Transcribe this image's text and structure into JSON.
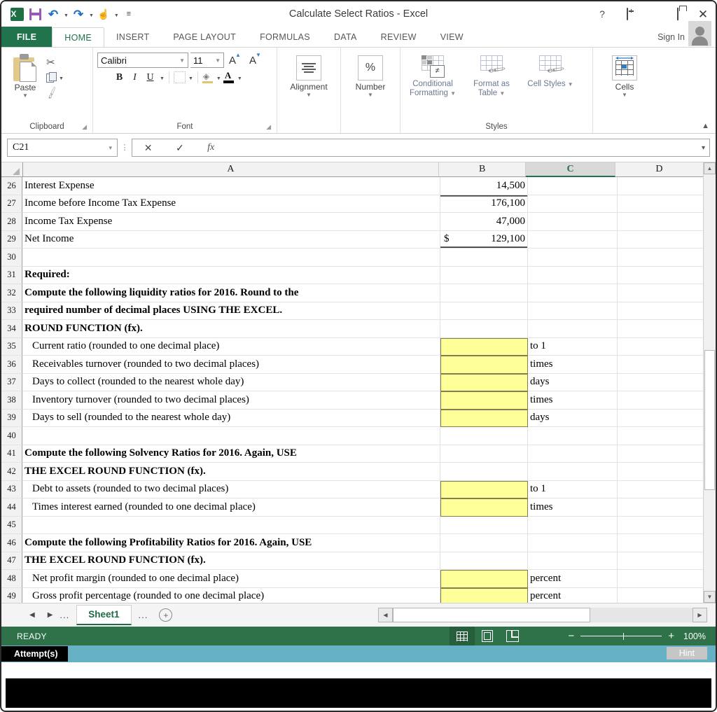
{
  "window": {
    "title": "Calculate Select Ratios - Excel",
    "help_icon": "?",
    "ribbon_display_icon": "ribbon-display-options-icon",
    "minimize_icon": "minimize-icon",
    "restore_icon": "restore-icon",
    "close_icon": "close-icon"
  },
  "quick_access": {
    "items": [
      {
        "name": "excel-logo-icon",
        "label": "X"
      },
      {
        "name": "save-icon",
        "label": ""
      },
      {
        "name": "undo-icon",
        "label": "↶"
      },
      {
        "name": "redo-icon",
        "label": "↷"
      },
      {
        "name": "touch-mode-icon",
        "label": "☝"
      },
      {
        "name": "customize-qat-icon",
        "label": "≡"
      }
    ]
  },
  "ribbon": {
    "tabs": [
      {
        "label": "FILE",
        "active": false,
        "file": true
      },
      {
        "label": "HOME",
        "active": true
      },
      {
        "label": "INSERT",
        "active": false
      },
      {
        "label": "PAGE LAYOUT",
        "active": false
      },
      {
        "label": "FORMULAS",
        "active": false
      },
      {
        "label": "DATA",
        "active": false
      },
      {
        "label": "REVIEW",
        "active": false
      },
      {
        "label": "VIEW",
        "active": false
      }
    ],
    "sign_in": "Sign In",
    "collapse_icon": "collapse-ribbon-icon",
    "groups": {
      "clipboard": {
        "label": "Clipboard",
        "paste": "Paste",
        "cut": "Cut",
        "copy": "Copy",
        "format_painter": "Format Painter",
        "dialog_launcher": "◢"
      },
      "font": {
        "label": "Font",
        "font_name": "Calibri",
        "font_size": "11",
        "grow_font": "A",
        "shrink_font": "A",
        "bold": "B",
        "italic": "I",
        "underline": "U",
        "borders": "borders-icon",
        "fill_color": "fill-color-icon",
        "font_color": "A",
        "dialog_launcher": "◢"
      },
      "alignment": {
        "label": "Alignment",
        "caret": "▾"
      },
      "number": {
        "label": "Number",
        "symbol": "%",
        "caret": "▾"
      },
      "styles": {
        "label": "Styles",
        "conditional_formatting": "Conditional Formatting",
        "format_as_table": "Format as Table",
        "cell_styles": "Cell Styles",
        "caret": "▾"
      },
      "cells": {
        "label": "Cells",
        "caret": "▾"
      }
    }
  },
  "formula_bar": {
    "name_box": "C21",
    "name_box_caret": "⌄",
    "cancel_icon": "✕",
    "enter_icon": "✓",
    "function_icon": "fx",
    "formula_value": "",
    "expand_caret": "⌄"
  },
  "grid": {
    "columns": [
      {
        "label": "A",
        "selected": false
      },
      {
        "label": "B",
        "selected": false
      },
      {
        "label": "C",
        "selected": true
      },
      {
        "label": "D",
        "selected": false
      }
    ],
    "rows": [
      {
        "n": "26",
        "a": "Interest Expense",
        "a_bold": false,
        "a_indent": false,
        "b": "14,500",
        "b_style": "",
        "c": ""
      },
      {
        "n": "27",
        "a": "Income before Income Tax Expense",
        "a_bold": false,
        "a_indent": false,
        "b": "176,100",
        "b_style": "topline",
        "c": ""
      },
      {
        "n": "28",
        "a": "Income Tax Expense",
        "a_bold": false,
        "a_indent": false,
        "b": "47,000",
        "b_style": "",
        "c": ""
      },
      {
        "n": "29",
        "a": "Net Income",
        "a_bold": false,
        "a_indent": false,
        "b": "129,100",
        "b_prefix": "$",
        "b_style": "topline dblbottom",
        "c": ""
      },
      {
        "n": "30",
        "a": "",
        "a_bold": false,
        "a_indent": false,
        "b": "",
        "b_style": "",
        "c": ""
      },
      {
        "n": "31",
        "a": "Required:",
        "a_bold": true,
        "a_indent": false,
        "b": "",
        "b_style": "",
        "c": ""
      },
      {
        "n": "32",
        "a": "Compute the following liquidity ratios for 2016. Round to the",
        "a_bold": true,
        "a_indent": false,
        "b": "",
        "b_style": "",
        "c": ""
      },
      {
        "n": "33",
        "a": "required number of decimal places USING THE EXCEL.",
        "a_bold": true,
        "a_indent": false,
        "b": "",
        "b_style": "",
        "c": ""
      },
      {
        "n": "34",
        "a": "ROUND FUNCTION (fx).",
        "a_bold": true,
        "a_indent": false,
        "b": "",
        "b_style": "",
        "c": ""
      },
      {
        "n": "35",
        "a": "Current ratio (rounded to one decimal place)",
        "a_bold": false,
        "a_indent": true,
        "b": "",
        "b_style": "yellow",
        "c": "to 1"
      },
      {
        "n": "36",
        "a": "Receivables turnover (rounded to two decimal places)",
        "a_bold": false,
        "a_indent": true,
        "b": "",
        "b_style": "yellow",
        "c": "times"
      },
      {
        "n": "37",
        "a": "Days to collect (rounded to the nearest whole day)",
        "a_bold": false,
        "a_indent": true,
        "b": "",
        "b_style": "yellow",
        "c": "days"
      },
      {
        "n": "38",
        "a": "Inventory turnover (rounded to two decimal places)",
        "a_bold": false,
        "a_indent": true,
        "b": "",
        "b_style": "yellow",
        "c": "times"
      },
      {
        "n": "39",
        "a": "Days to sell (rounded to the nearest whole day)",
        "a_bold": false,
        "a_indent": true,
        "b": "",
        "b_style": "yellow",
        "c": "days"
      },
      {
        "n": "40",
        "a": "",
        "a_bold": false,
        "a_indent": false,
        "b": "",
        "b_style": "",
        "c": ""
      },
      {
        "n": "41",
        "a": "Compute the following Solvency Ratios for 2016. Again, USE",
        "a_bold": true,
        "a_indent": false,
        "b": "",
        "b_style": "",
        "c": ""
      },
      {
        "n": "42",
        "a": "THE EXCEL ROUND FUNCTION (fx).",
        "a_bold": true,
        "a_indent": false,
        "b": "",
        "b_style": "",
        "c": ""
      },
      {
        "n": "43",
        "a": "Debt to assets (rounded to two decimal places)",
        "a_bold": false,
        "a_indent": true,
        "b": "",
        "b_style": "yellow",
        "c": "to 1"
      },
      {
        "n": "44",
        "a": "Times interest earned (rounded to one decimal place)",
        "a_bold": false,
        "a_indent": true,
        "b": "",
        "b_style": "yellow",
        "c": "times"
      },
      {
        "n": "45",
        "a": "",
        "a_bold": false,
        "a_indent": false,
        "b": "",
        "b_style": "",
        "c": ""
      },
      {
        "n": "46",
        "a": "Compute the following Profitability Ratios for 2016. Again, USE",
        "a_bold": true,
        "a_indent": false,
        "b": "",
        "b_style": "",
        "c": ""
      },
      {
        "n": "47",
        "a": "THE EXCEL ROUND FUNCTION (fx).",
        "a_bold": true,
        "a_indent": false,
        "b": "",
        "b_style": "",
        "c": ""
      },
      {
        "n": "48",
        "a": "Net profit margin (rounded to one decimal place)",
        "a_bold": false,
        "a_indent": true,
        "b": "",
        "b_style": "yellow",
        "c": "percent"
      },
      {
        "n": "49",
        "a": "Gross profit percentage (rounded to one decimal place)",
        "a_bold": false,
        "a_indent": true,
        "b": "",
        "b_style": "yellow",
        "c": "percent"
      }
    ],
    "scroll_up_icon": "▲",
    "scroll_down_icon": "▼"
  },
  "sheet_bar": {
    "first_arrow": "◀",
    "last_arrow": "▶",
    "left_ellipsis": "...",
    "right_ellipsis": "...",
    "active_sheet": "Sheet1",
    "new_sheet": "+",
    "hscroll_left": "◀",
    "hscroll_right": "▶"
  },
  "status_bar": {
    "mode": "READY",
    "view_normal": "normal-view-icon",
    "view_page_layout": "page-layout-view-icon",
    "view_page_break": "page-break-preview-icon",
    "zoom_out": "−",
    "zoom_in": "+",
    "zoom_level": "100%"
  },
  "attempt_bar": {
    "label": "Attempt(s)",
    "hint_button": "Hint"
  },
  "colors": {
    "excel_green": "#21734d",
    "status_green": "#2f7249",
    "attempt_teal": "#66b2c4",
    "input_yellow": "#ffff99"
  }
}
